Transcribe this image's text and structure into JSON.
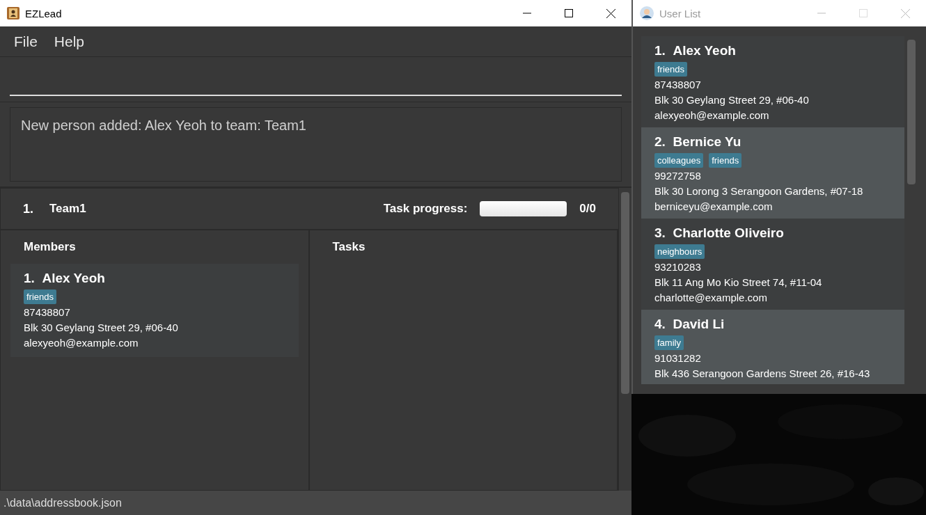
{
  "main_window": {
    "title": "EZLead"
  },
  "menu": [
    "File",
    "Help"
  ],
  "result_display": {
    "text": "New person added: Alex Yeoh to team: Team1"
  },
  "team": {
    "index": "1.",
    "name": "Team1",
    "progress_label": "Task progress:",
    "progress": {
      "level": 0
    },
    "progress_text": "0/0",
    "members_title": "Members",
    "tasks_title": "Tasks",
    "members": [
      {
        "index": "1.",
        "name": "Alex Yeoh",
        "tags": [
          "friends"
        ],
        "phone": "87438807",
        "address": "Blk 30 Geylang Street 29, #06-40",
        "email": "alexyeoh@example.com"
      }
    ]
  },
  "status_bar": {
    "path": ".\\data\\addressbook.json"
  },
  "user_list_window": {
    "title": "User List",
    "persons": [
      {
        "index": "1.",
        "name": "Alex Yeoh",
        "tags": [
          "friends"
        ],
        "phone": "87438807",
        "address": "Blk 30 Geylang Street 29, #06-40",
        "email": "alexyeoh@example.com"
      },
      {
        "index": "2.",
        "name": "Bernice Yu",
        "tags": [
          "colleagues",
          "friends"
        ],
        "phone": "99272758",
        "address": "Blk 30 Lorong 3 Serangoon Gardens, #07-18",
        "email": "berniceyu@example.com"
      },
      {
        "index": "3.",
        "name": "Charlotte Oliveiro",
        "tags": [
          "neighbours"
        ],
        "phone": "93210283",
        "address": "Blk 11 Ang Mo Kio Street 74, #11-04",
        "email": "charlotte@example.com"
      },
      {
        "index": "4.",
        "name": "David Li",
        "tags": [
          "family"
        ],
        "phone": "91031282",
        "address": "Blk 436 Serangoon Gardens Street 26, #16-43"
      }
    ]
  }
}
